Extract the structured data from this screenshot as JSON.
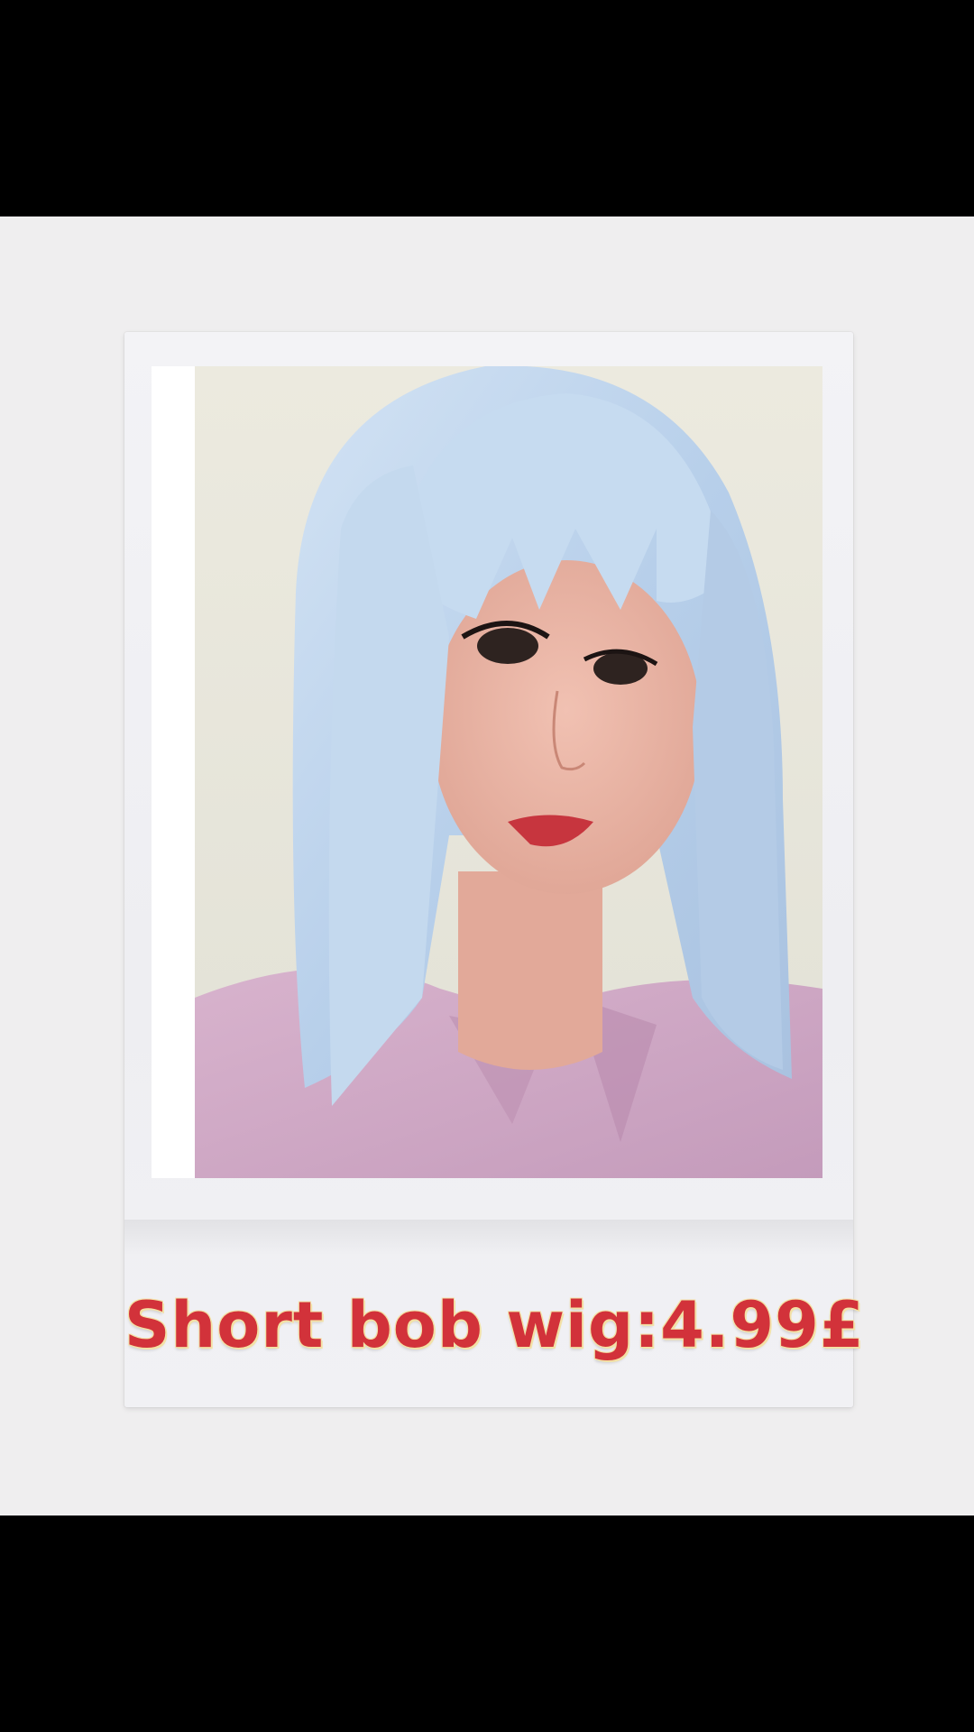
{
  "caption": "Short bob wig:4.99£",
  "colors": {
    "caption_text": "#d2323a",
    "caption_outline": "#f3e1a6",
    "background": "#efeeef",
    "letterbox": "#000000",
    "hair": "#b9d3ee",
    "shirt": "#cda7c4"
  },
  "photo": {
    "subject": "portrait-photo"
  }
}
